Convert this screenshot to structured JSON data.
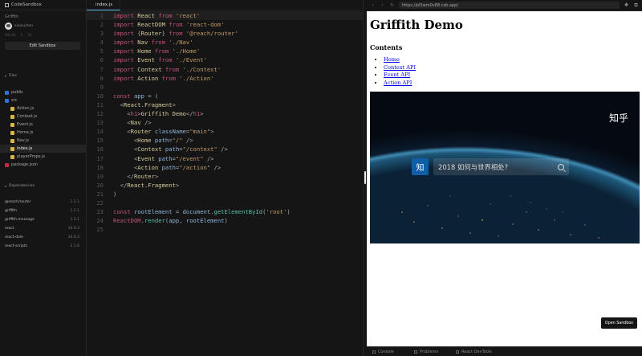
{
  "sidebar": {
    "app_title": "CodeSandbox",
    "project_name": "Griffith",
    "owner": "xiaosuhen",
    "stats": [
      "304.8k",
      "2",
      "50"
    ],
    "edit_label": "Edit Sandbox",
    "files_title": "Files",
    "files": [
      {
        "name": "public",
        "kind": "folder",
        "depth": 0
      },
      {
        "name": "src",
        "kind": "folder",
        "depth": 0
      },
      {
        "name": "Action.js",
        "kind": "js",
        "depth": 1
      },
      {
        "name": "Context.js",
        "kind": "js",
        "depth": 1
      },
      {
        "name": "Event.js",
        "kind": "js",
        "depth": 1
      },
      {
        "name": "Home.js",
        "kind": "js",
        "depth": 1
      },
      {
        "name": "Nav.js",
        "kind": "js",
        "depth": 1
      },
      {
        "name": "index.js",
        "kind": "js",
        "depth": 1,
        "active": true
      },
      {
        "name": "playerProps.js",
        "kind": "js",
        "depth": 1
      },
      {
        "name": "package.json",
        "kind": "json",
        "depth": 0
      }
    ],
    "deps_title": "Dependencies",
    "dependencies": [
      {
        "name": "@reach/router",
        "version": "1.2.1"
      },
      {
        "name": "griffith",
        "version": "1.2.1"
      },
      {
        "name": "griffith-message",
        "version": "1.2.1"
      },
      {
        "name": "react",
        "version": "16.8.3"
      },
      {
        "name": "react-dom",
        "version": "16.8.3"
      },
      {
        "name": "react-scripts",
        "version": "2.1.8"
      }
    ]
  },
  "editor": {
    "tab_label": "index.js",
    "lines": [
      [
        [
          "k",
          "import "
        ],
        [
          "t",
          "React"
        ],
        [
          "k",
          " from "
        ],
        [
          "s",
          "'react'"
        ]
      ],
      [
        [
          "k",
          "import "
        ],
        [
          "t",
          "ReactDOM"
        ],
        [
          "k",
          " from "
        ],
        [
          "s",
          "'react-dom'"
        ]
      ],
      [
        [
          "k",
          "import "
        ],
        [
          "p",
          "{"
        ],
        [
          "t",
          "Router"
        ],
        [
          "p",
          "}"
        ],
        [
          "k",
          " from "
        ],
        [
          "s",
          "'@reach/router'"
        ]
      ],
      [
        [
          "k",
          "import "
        ],
        [
          "t",
          "Nav"
        ],
        [
          "k",
          " from "
        ],
        [
          "s",
          "'./Nav'"
        ]
      ],
      [
        [
          "k",
          "import "
        ],
        [
          "t",
          "Home"
        ],
        [
          "k",
          " from "
        ],
        [
          "s",
          "'./Home'"
        ]
      ],
      [
        [
          "k",
          "import "
        ],
        [
          "t",
          "Event"
        ],
        [
          "k",
          " from "
        ],
        [
          "s",
          "'./Event'"
        ]
      ],
      [
        [
          "k",
          "import "
        ],
        [
          "t",
          "Context"
        ],
        [
          "k",
          " from "
        ],
        [
          "s",
          "'./Context'"
        ]
      ],
      [
        [
          "k",
          "import "
        ],
        [
          "t",
          "Action"
        ],
        [
          "k",
          " from "
        ],
        [
          "s",
          "'./Action'"
        ]
      ],
      [],
      [
        [
          "k",
          "const "
        ],
        [
          "a",
          "app"
        ],
        [
          "p",
          " = ("
        ]
      ],
      [
        [
          "p",
          "  <"
        ],
        [
          "t",
          "React.Fragment"
        ],
        [
          "p",
          ">"
        ]
      ],
      [
        [
          "p",
          "    <"
        ],
        [
          "k",
          "h1"
        ],
        [
          "p",
          ">"
        ],
        [
          "t",
          "Griffith Demo"
        ],
        [
          "p",
          "</"
        ],
        [
          "k",
          "h1"
        ],
        [
          "p",
          ">"
        ]
      ],
      [
        [
          "p",
          "    <"
        ],
        [
          "t",
          "Nav"
        ],
        [
          "p",
          " />"
        ]
      ],
      [
        [
          "p",
          "    <"
        ],
        [
          "t",
          "Router"
        ],
        [
          "a",
          " className"
        ],
        [
          "p",
          "="
        ],
        [
          "s",
          "\"main\""
        ],
        [
          "p",
          ">"
        ]
      ],
      [
        [
          "p",
          "      <"
        ],
        [
          "t",
          "Home"
        ],
        [
          "a",
          " path"
        ],
        [
          "p",
          "="
        ],
        [
          "s",
          "\"/\""
        ],
        [
          "p",
          " />"
        ]
      ],
      [
        [
          "p",
          "      <"
        ],
        [
          "t",
          "Context"
        ],
        [
          "a",
          " path"
        ],
        [
          "p",
          "="
        ],
        [
          "s",
          "\"/context\""
        ],
        [
          "p",
          " />"
        ]
      ],
      [
        [
          "p",
          "      <"
        ],
        [
          "t",
          "Event"
        ],
        [
          "a",
          " path"
        ],
        [
          "p",
          "="
        ],
        [
          "s",
          "\"/event\""
        ],
        [
          "p",
          " />"
        ]
      ],
      [
        [
          "p",
          "      <"
        ],
        [
          "t",
          "Action"
        ],
        [
          "a",
          " path"
        ],
        [
          "p",
          "="
        ],
        [
          "s",
          "\"/action\""
        ],
        [
          "p",
          " />"
        ]
      ],
      [
        [
          "p",
          "    </"
        ],
        [
          "t",
          "Router"
        ],
        [
          "p",
          ">"
        ]
      ],
      [
        [
          "p",
          "  </"
        ],
        [
          "t",
          "React.Fragment"
        ],
        [
          "p",
          ">"
        ]
      ],
      [
        [
          "p",
          ")"
        ]
      ],
      [],
      [
        [
          "k",
          "const "
        ],
        [
          "a",
          "rootElement"
        ],
        [
          "p",
          " = "
        ],
        [
          "a",
          "document"
        ],
        [
          "p",
          "."
        ],
        [
          "f",
          "getElementById"
        ],
        [
          "p",
          "("
        ],
        [
          "s",
          "'root'"
        ],
        [
          "p",
          ")"
        ]
      ],
      [
        [
          "k",
          "ReactDOM"
        ],
        [
          "p",
          "."
        ],
        [
          "f",
          "render"
        ],
        [
          "p",
          "("
        ],
        [
          "a",
          "app"
        ],
        [
          "p",
          ", "
        ],
        [
          "a",
          "rootElement"
        ],
        [
          "p",
          ")"
        ]
      ],
      []
    ]
  },
  "preview": {
    "url": "https://pl5wm0v88.csb.app/",
    "heading": "Griffith Demo",
    "contents_label": "Contents",
    "links": [
      "Home",
      "Context API",
      "Event API",
      "Action API"
    ],
    "video": {
      "watermark": "知乎",
      "logo": "知",
      "query": "2018 如何与世界相处?"
    },
    "open_label": "Open Sandbox"
  },
  "devtools": {
    "tabs": [
      "Console",
      "Problems",
      "React DevTools"
    ]
  },
  "colors": {
    "accent": "#6cc7f6",
    "keyword": "#c5527d",
    "string": "#bf9a6a",
    "folder": "#2e6fd9",
    "js_file": "#d9b83b",
    "json_file": "#c8273f",
    "link": "#0000ee"
  }
}
